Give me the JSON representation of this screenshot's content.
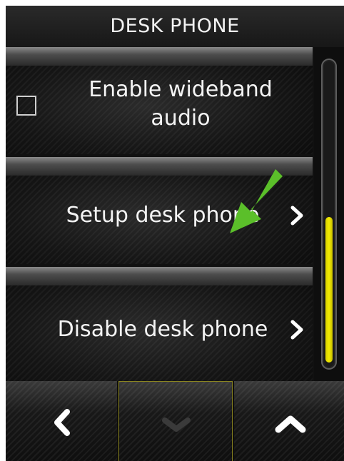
{
  "header": {
    "title": "DESK PHONE"
  },
  "list": {
    "items": [
      {
        "label": "Enable wideband audio",
        "line1": "Enable wideband",
        "line2": "audio",
        "control": "checkbox",
        "checked": false
      },
      {
        "label": "Setup desk phone",
        "control": "chevron-right-icon"
      },
      {
        "label": "Disable desk phone",
        "control": "chevron-right-icon"
      }
    ]
  },
  "annotation": {
    "icon": "green-arrow-icon",
    "color": "#5bbf2a",
    "points_to": "Setup desk phone"
  },
  "scrollbar": {
    "thumb_color": "#f2ea00",
    "position": "bottom"
  },
  "footer": {
    "buttons": [
      {
        "icon": "chevron-left-icon",
        "action": "back"
      },
      {
        "icon": "chevron-down-icon",
        "action": "scroll-down",
        "disabled": true
      },
      {
        "icon": "chevron-up-icon",
        "action": "scroll-up"
      }
    ]
  },
  "colors": {
    "accent": "#f2ea00",
    "text": "#f4f4f4",
    "background": "#111111"
  }
}
